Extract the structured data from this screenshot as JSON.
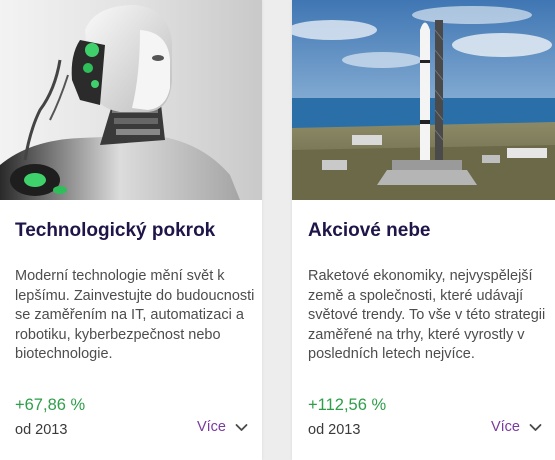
{
  "cards": [
    {
      "title": "Technologický pokrok",
      "description": "Moderní technologie mění svět k lepšímu. Zainvestujte do budoucnosti se zaměřením na IT, automatizaci a robotiku, kyberbezpečnost nebo biotechnologie.",
      "return": "+67,86 %",
      "since": "od 2013",
      "more_label": "Více",
      "image_icon": "robot-image"
    },
    {
      "title": "Akciové nebe",
      "description": "Raketové ekonomiky, nejvyspělejší země a společnosti, které udávají světové trendy. To vše v této strategii zaměřené na trhy, které vyrostly v posledních letech nejvíce.",
      "return": "+112,56 %",
      "since": "od 2013",
      "more_label": "Více",
      "image_icon": "rocket-launch-image"
    }
  ],
  "colors": {
    "title": "#1f1548",
    "return_positive": "#2e9e4a",
    "link": "#7a3b9e",
    "body_text": "#4d4d4d"
  }
}
